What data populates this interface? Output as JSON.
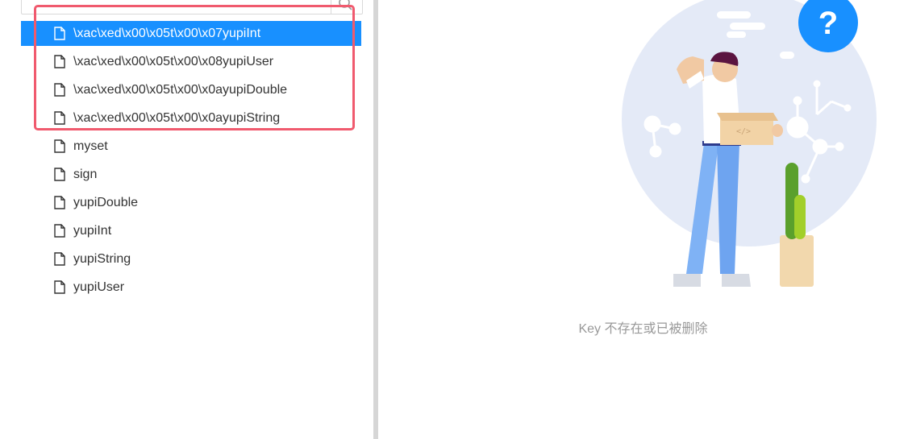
{
  "search": {
    "icon": "search-icon"
  },
  "tree": {
    "items": [
      {
        "label": "\\xac\\xed\\x00\\x05t\\x00\\x07yupiInt",
        "selected": true,
        "icon": "file-icon"
      },
      {
        "label": "\\xac\\xed\\x00\\x05t\\x00\\x08yupiUser",
        "selected": false,
        "icon": "file-icon"
      },
      {
        "label": "\\xac\\xed\\x00\\x05t\\x00\\x0ayupiDouble",
        "selected": false,
        "icon": "file-icon"
      },
      {
        "label": "\\xac\\xed\\x00\\x05t\\x00\\x0ayupiString",
        "selected": false,
        "icon": "file-icon"
      },
      {
        "label": "myset",
        "selected": false,
        "icon": "file-icon"
      },
      {
        "label": "sign",
        "selected": false,
        "icon": "file-icon"
      },
      {
        "label": "yupiDouble",
        "selected": false,
        "icon": "file-icon"
      },
      {
        "label": "yupiInt",
        "selected": false,
        "icon": "file-icon"
      },
      {
        "label": "yupiString",
        "selected": false,
        "icon": "file-icon"
      },
      {
        "label": "yupiUser",
        "selected": false,
        "icon": "file-icon"
      }
    ]
  },
  "empty_state": {
    "message": "Key 不存在或已被删除",
    "badge_text": "?",
    "illustration": "confused-person-with-box"
  },
  "colors": {
    "selected_bg": "#1890ff",
    "highlight_border": "#f05a6e",
    "divider": "#d6d6d6"
  }
}
